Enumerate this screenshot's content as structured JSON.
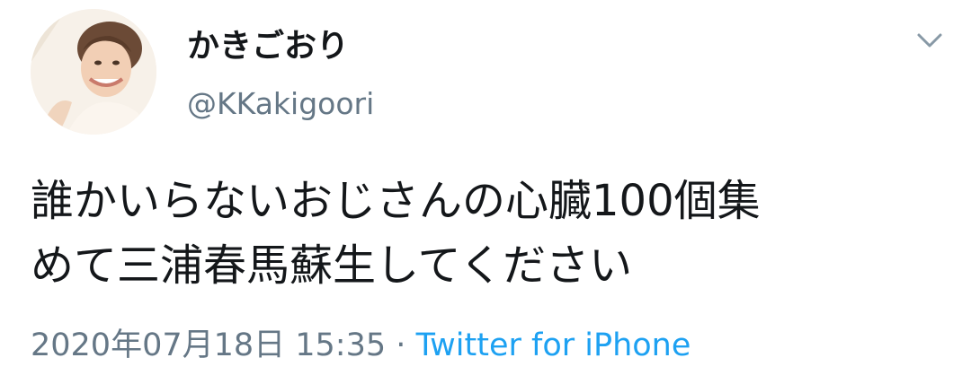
{
  "user": {
    "display_name": "かきごおり",
    "handle": "@KKakigoori"
  },
  "tweet": {
    "lines": [
      "誰かいらないおじさんの心臓100個集",
      "めて三浦春馬蘇生してください"
    ],
    "timestamp": "2020年07月18日 15:35",
    "separator": "·",
    "source": "Twitter for iPhone"
  },
  "icons": {
    "menu": "chevron-down-icon"
  },
  "colors": {
    "text": "#14171a",
    "secondary": "#657786",
    "link": "#1da1f2"
  }
}
